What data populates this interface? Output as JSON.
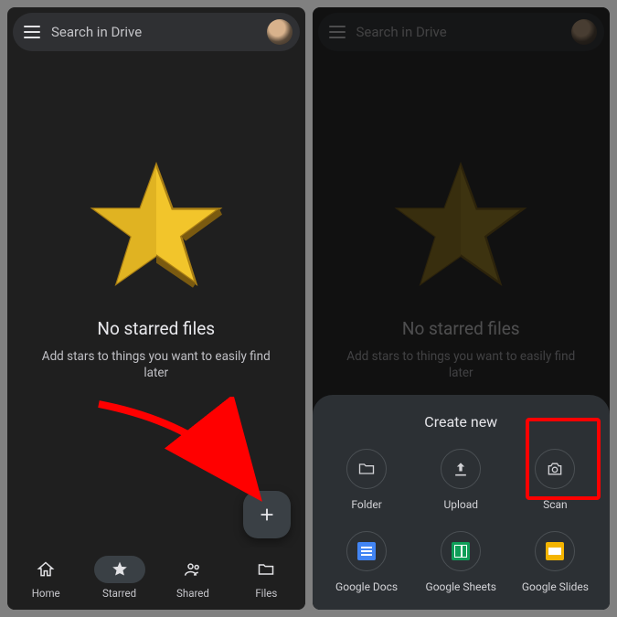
{
  "search": {
    "placeholder": "Search in Drive"
  },
  "empty": {
    "title": "No starred files",
    "subtitle": "Add stars to things you want to easily find later"
  },
  "nav": {
    "home": "Home",
    "starred": "Starred",
    "shared": "Shared",
    "files": "Files"
  },
  "sheet": {
    "title": "Create new",
    "items": {
      "folder": "Folder",
      "upload": "Upload",
      "scan": "Scan",
      "docs": "Google Docs",
      "sheets": "Google Sheets",
      "slides": "Google Slides"
    }
  }
}
